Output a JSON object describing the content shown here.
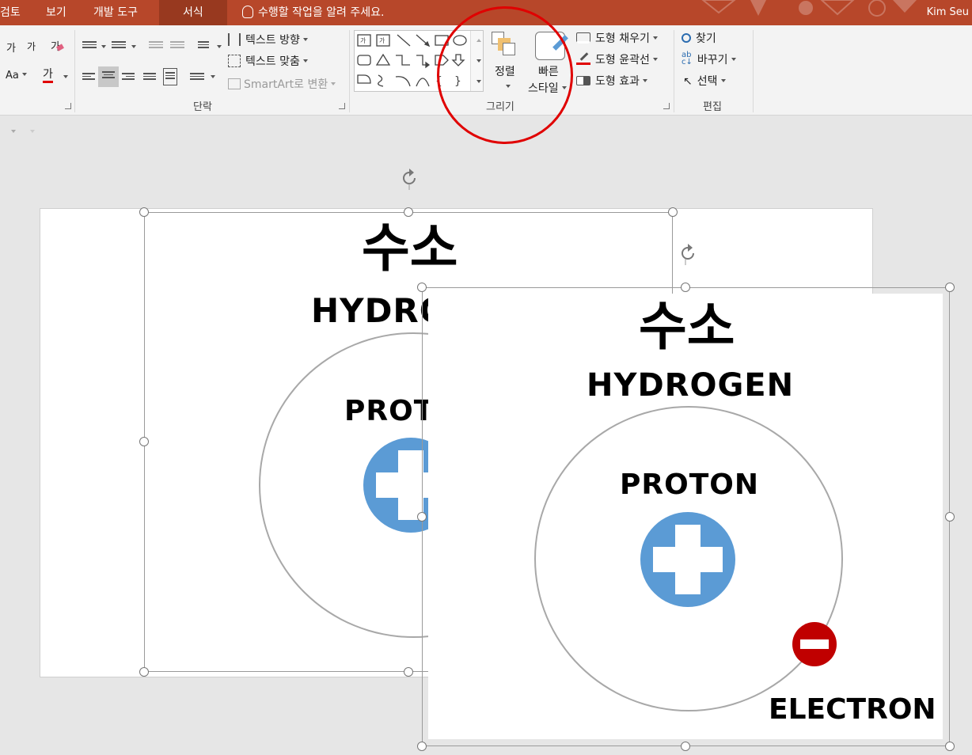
{
  "menu": {
    "tabs": [
      {
        "label": "검토"
      },
      {
        "label": "보기"
      },
      {
        "label": "개발 도구"
      },
      {
        "label": "서식"
      }
    ],
    "tell_me": "수행할 작업을 알려 주세요.",
    "user": "Kim Seu"
  },
  "ribbon": {
    "font_group": {
      "grow_font": "가",
      "shrink_font": "가",
      "clear_format": "가",
      "change_case": "Aa",
      "font_color_glyph": "가"
    },
    "paragraph_group": {
      "label": "단락",
      "text_direction": "텍스트 방향",
      "align_text": "텍스트 맞춤",
      "smartart": "SmartArt로 변환"
    },
    "drawing_group": {
      "label": "그리기",
      "arrange": "정렬",
      "quick_styles_line1": "빠른",
      "quick_styles_line2": "스타일",
      "shape_fill": "도형 채우기",
      "shape_outline": "도형 윤곽선",
      "shape_effects": "도형 효과"
    },
    "editing_group": {
      "label": "편집",
      "find": "찾기",
      "replace": "바꾸기",
      "select": "선택"
    }
  },
  "slide_back": {
    "title_ko": "수소",
    "title_en": "HYDROG",
    "proton_label": "PROT"
  },
  "slide_front": {
    "title_ko": "수소",
    "title_en": "HYDROGEN",
    "proton_label": "PROTON",
    "electron_label": "ELECTRON"
  },
  "colors": {
    "menubar": "#b7472a",
    "active_tab": "#98391f",
    "proton": "#5b9bd5",
    "electron": "#c00000",
    "highlight_circle": "#e00000"
  }
}
